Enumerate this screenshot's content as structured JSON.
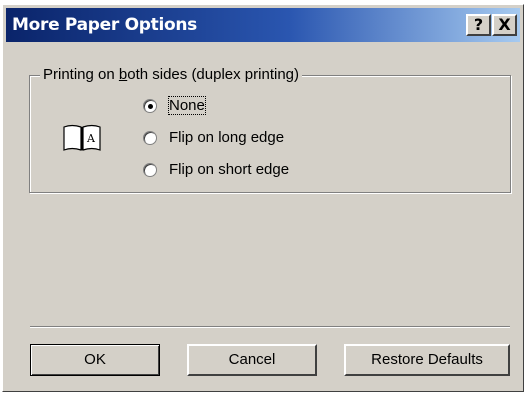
{
  "window": {
    "title": "More Paper Options",
    "help_label": "?",
    "close_label": "X"
  },
  "duplex": {
    "group_label": "Printing on both sides (duplex printing)",
    "icon": "open-book-icon",
    "options": [
      {
        "label": "None",
        "checked": true
      },
      {
        "label": "Flip on long edge",
        "checked": false
      },
      {
        "label": "Flip on short edge",
        "checked": false
      }
    ]
  },
  "buttons": {
    "ok": "OK",
    "cancel": "Cancel",
    "restore_defaults": "Restore Defaults"
  }
}
